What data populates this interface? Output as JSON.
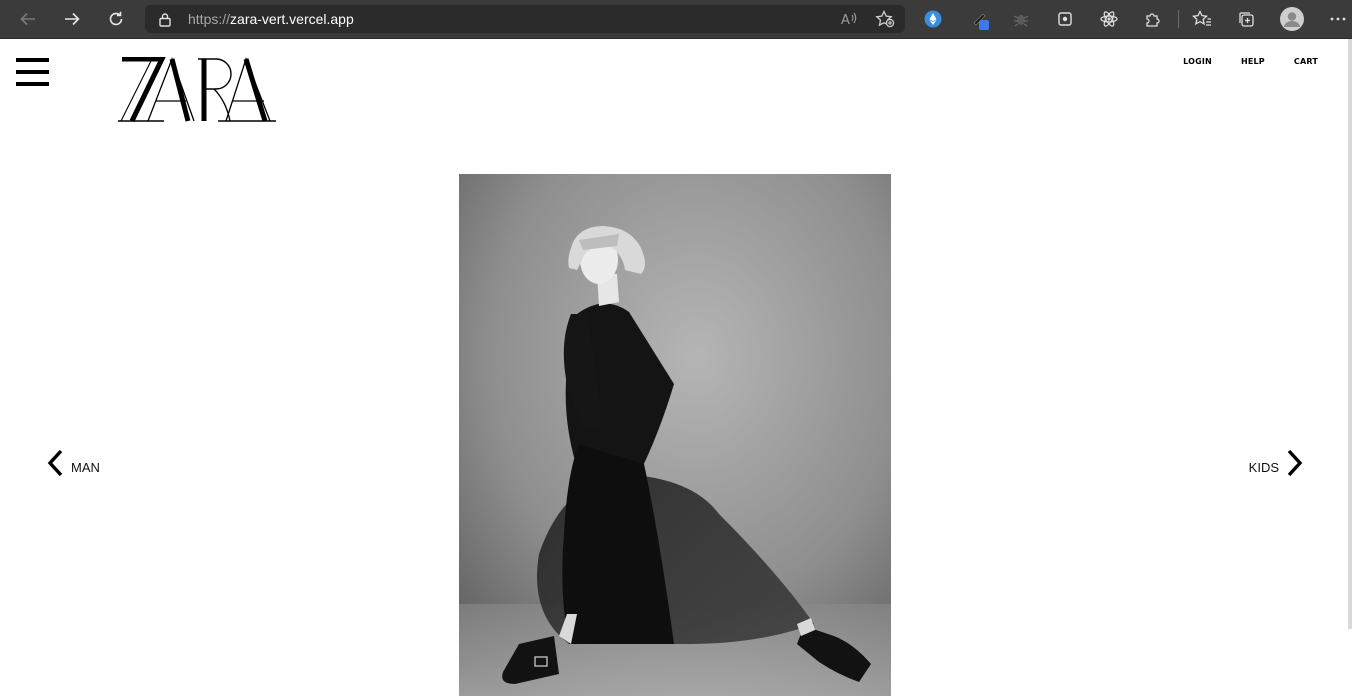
{
  "browser": {
    "url_protocol": "https://",
    "url_host": "zara-vert.vercel.app"
  },
  "header": {
    "logo_text": "ZARA",
    "links": [
      {
        "label": "LOGIN"
      },
      {
        "label": "HELP"
      },
      {
        "label": "CART"
      }
    ]
  },
  "carousel": {
    "prev_label": "MAN",
    "next_label": "KIDS"
  }
}
